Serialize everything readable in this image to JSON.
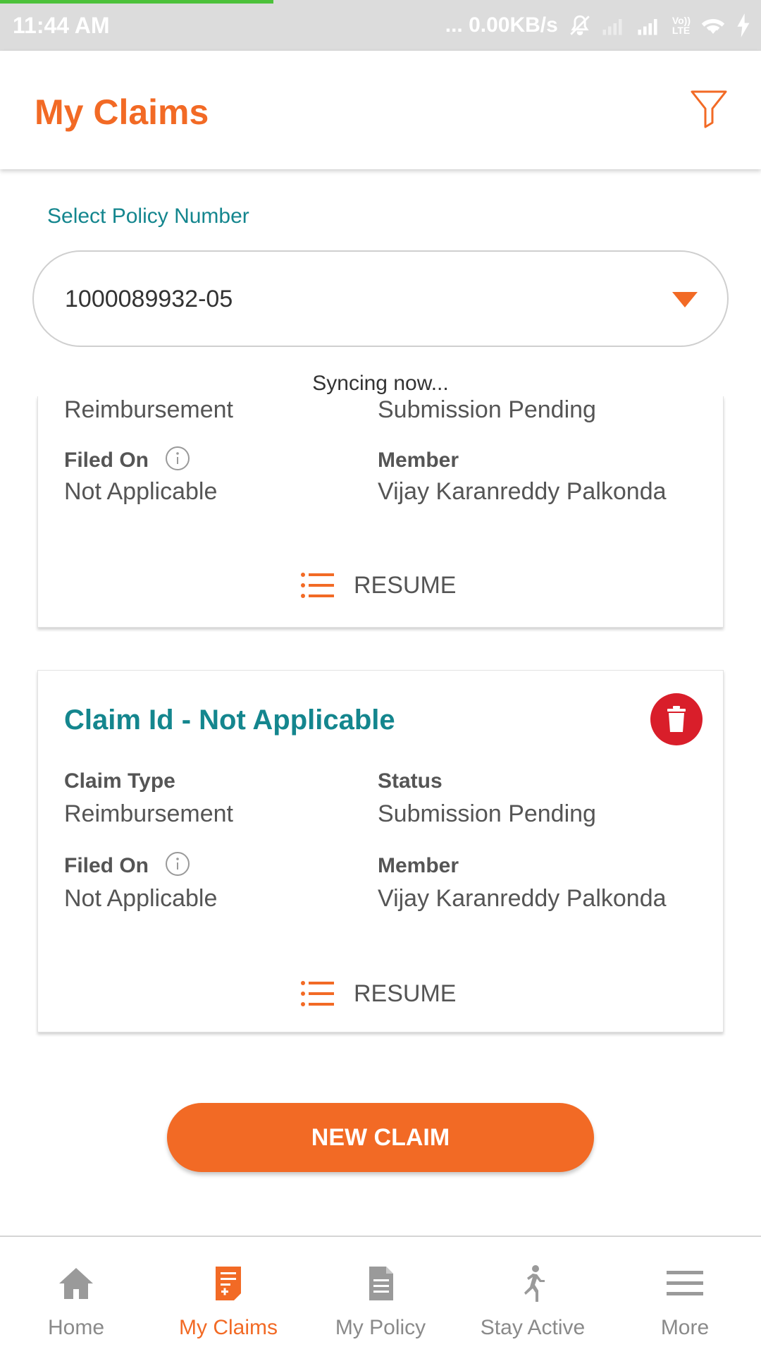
{
  "status_bar": {
    "time": "11:44 AM",
    "network_speed": "... 0.00KB/s",
    "icons": [
      "mute-icon",
      "signal-weak-icon",
      "signal-icon",
      "volte-icon",
      "wifi-icon",
      "charging-icon"
    ],
    "volte_top": "Vo))",
    "volte_bottom": "LTE"
  },
  "header": {
    "title": "My Claims",
    "filter_icon": "filter-icon"
  },
  "policy": {
    "label": "Select Policy Number",
    "value": "1000089932-05"
  },
  "sync_text": "Syncing now...",
  "claims": [
    {
      "claim_type_value": "Reimbursement",
      "status_value": "Submission Pending",
      "filed_on_label": "Filed On",
      "filed_on_value": "Not Applicable",
      "member_label": "Member",
      "member_value": "Vijay Karanreddy Palkonda",
      "resume_label": "RESUME"
    },
    {
      "title": "Claim Id - Not Applicable",
      "claim_type_label": "Claim Type",
      "claim_type_value": "Reimbursement",
      "status_label": "Status",
      "status_value": "Submission Pending",
      "filed_on_label": "Filed On",
      "filed_on_value": "Not Applicable",
      "member_label": "Member",
      "member_value": "Vijay Karanreddy Palkonda",
      "resume_label": "RESUME"
    }
  ],
  "new_claim_label": "NEW CLAIM",
  "bottom_nav": [
    {
      "label": "Home",
      "icon": "home-icon",
      "active": false
    },
    {
      "label": "My Claims",
      "icon": "claims-icon",
      "active": true
    },
    {
      "label": "My Policy",
      "icon": "policy-icon",
      "active": false
    },
    {
      "label": "Stay Active",
      "icon": "running-icon",
      "active": false
    },
    {
      "label": "More",
      "icon": "menu-icon",
      "active": false
    }
  ],
  "colors": {
    "brand_orange": "#f26a25",
    "teal": "#14868e",
    "delete_red": "#d91e2a",
    "inactive_gray": "#8a8a8a"
  }
}
